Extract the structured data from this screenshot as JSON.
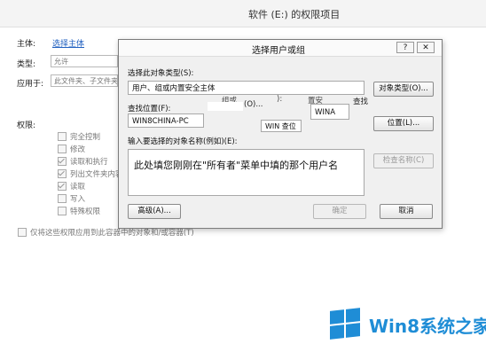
{
  "background_window": {
    "title": "软件 (E:) 的权限项目",
    "principal_label": "主体:",
    "principal_link": "选择主体",
    "type_label": "类型:",
    "type_value": "允许",
    "applies_label": "应用于:",
    "applies_value": "此文件夹、子文件夹和文件",
    "permissions_label": "权限:",
    "permissions": [
      {
        "label": "完全控制",
        "checked": false
      },
      {
        "label": "修改",
        "checked": false
      },
      {
        "label": "读取和执行",
        "checked": true
      },
      {
        "label": "列出文件夹内容",
        "checked": true
      },
      {
        "label": "读取",
        "checked": true
      },
      {
        "label": "写入",
        "checked": false
      },
      {
        "label": "特殊权限",
        "checked": false
      }
    ],
    "apply_only_label": "仅将这些权限应用到此容器中的对象和/或容器(T)"
  },
  "dialog": {
    "title": "选择用户或组",
    "help_btn": "?",
    "close_btn": "✕",
    "object_type_label": "选择此对象类型(S):",
    "object_type_value": "用户、组或内置安全主体",
    "object_type_btn": "对象类型(O)...",
    "location_label": "查找位置(F):",
    "location_value": "WIN8CHINA-PC",
    "location_btn": "位置(L)...",
    "names_label": "输入要选择的对象名称(例如)(E):",
    "names_value": "此处填您刚刚在\"所有者\"菜单中填的那个用户名",
    "check_names_btn": "检查名称(C)",
    "advanced_btn": "高级(A)...",
    "ok_btn": "确定",
    "cancel_btn": "取消",
    "ghost_texts": [
      "组或",
      "(O)...",
      "):",
      "置安",
      "WINA",
      "查找",
      "WIN 查位"
    ]
  },
  "logo": {
    "text": "Win8系统之家",
    "color": "#1f8dd6"
  }
}
